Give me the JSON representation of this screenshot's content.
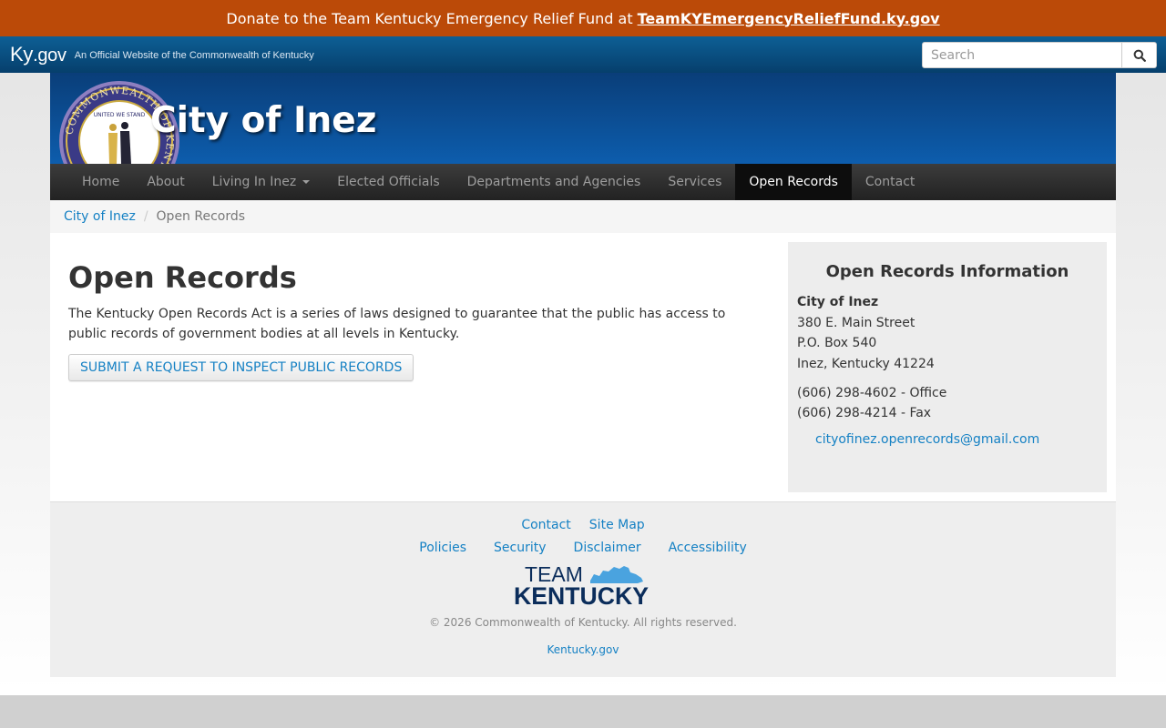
{
  "banner": {
    "text": "Donate to the Team Kentucky Emergency Relief Fund at",
    "link_label": "TeamKYEmergencyReliefFund.ky.gov"
  },
  "kygov": {
    "logo_main": "Ky",
    "logo_suffix": ".gov",
    "tagline": "An Official Website of the Commonwealth of Kentucky",
    "search_placeholder": "Search",
    "search_icon": "magnifier-icon"
  },
  "header": {
    "site_title": "City of Inez",
    "seal": {
      "ring_text": "COMMONWEALTH OF KENTUCKY",
      "motto": "UNITED WE STAND"
    },
    "colors": {
      "top": "#0a3e79",
      "bottom": "#0d5dad"
    }
  },
  "nav": {
    "items": [
      {
        "label": "Home",
        "active": false
      },
      {
        "label": "About",
        "active": false
      },
      {
        "label": "Living In Inez",
        "active": false,
        "dropdown": true
      },
      {
        "label": "Elected Officials",
        "active": false
      },
      {
        "label": "Departments and Agencies",
        "active": false
      },
      {
        "label": "Services",
        "active": false
      },
      {
        "label": "Open Records",
        "active": true
      },
      {
        "label": "Contact",
        "active": false
      }
    ]
  },
  "breadcrumb": {
    "home": "City of Inez",
    "separator": "/",
    "current": "Open Records"
  },
  "main": {
    "title": "Open Records",
    "intro": "The Kentucky Open Records Act is a series of laws designed to guarantee that the public has access to public records of government bodies at all levels in Kentucky.",
    "request_button": "SUBMIT A REQUEST TO INSPECT PUBLIC RECORDS"
  },
  "sidebar": {
    "title": "Open Records Information",
    "org": "City of Inez",
    "street": "380 E. Main Street",
    "po_box": "P.O. Box 540",
    "city_state": "Inez, Kentucky 41224",
    "phone_office": "(606) 298-4602 - Office",
    "phone_fax": "(606) 298-4214 - Fax",
    "email": "cityofinez.openrecords@gmail.com"
  },
  "footer": {
    "links_row1": [
      "Contact",
      "Site Map"
    ],
    "links_row2": [
      "Policies",
      "Security",
      "Disclaimer",
      "Accessibility"
    ],
    "logo_top": "TEAM",
    "logo_bottom": "KENTUCKY",
    "copyright": "© 2026 Commonwealth of Kentucky. All rights reserved.",
    "kygov_link": "Kentucky.gov"
  },
  "colors": {
    "banner": "#bb4a08",
    "link": "#1581c4",
    "navbar": "#222222",
    "team_ky_navy": "#0b2d5b",
    "team_ky_blue": "#4aa3df"
  }
}
